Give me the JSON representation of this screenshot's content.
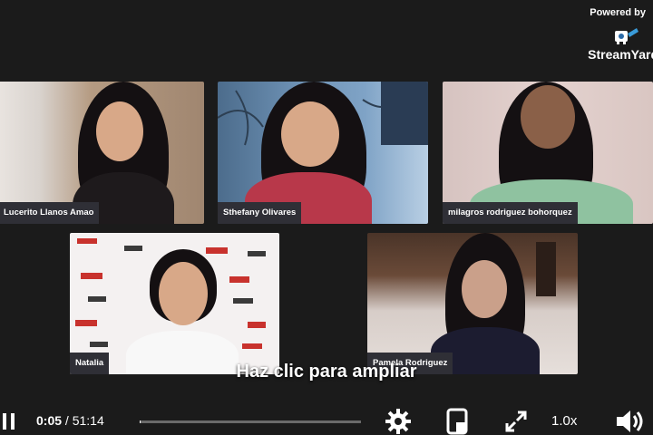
{
  "branding": {
    "powered_by": "Powered by",
    "name": "StreamYard"
  },
  "participants": [
    {
      "name": "Lucerito Llanos Amao"
    },
    {
      "name": "Sthefany Olivares"
    },
    {
      "name": "milagros rodriguez bohorquez"
    },
    {
      "name": "Natalia"
    },
    {
      "name": "Pamela Rodriguez"
    }
  ],
  "caption": "Haz clic para ampliar",
  "player": {
    "current_time": "0:05",
    "separator": " / ",
    "duration": "51:14",
    "progress": 0.0016,
    "speed": "1.0x"
  },
  "icons": {
    "play": "pause-icon",
    "settings": "gear-icon",
    "pip": "picture-in-picture-icon",
    "fullscreen": "fullscreen-icon",
    "volume": "volume-icon"
  }
}
